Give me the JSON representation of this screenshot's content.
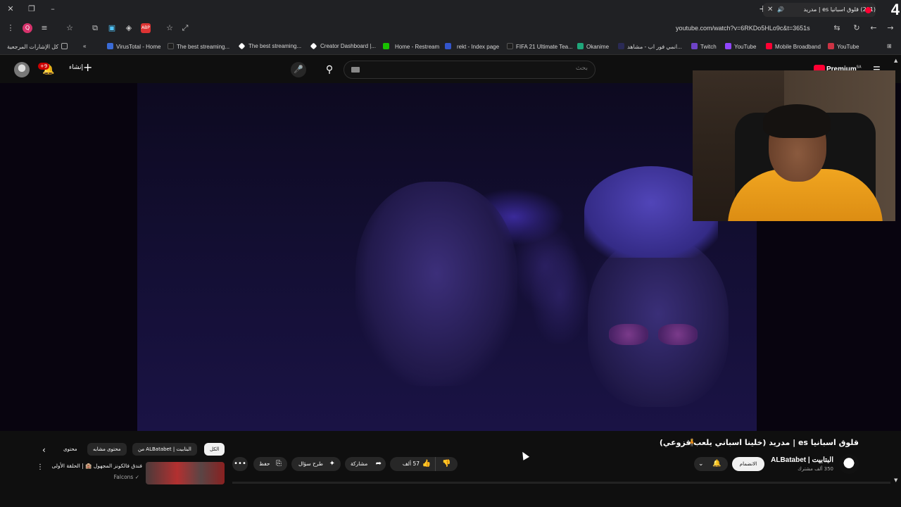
{
  "browser": {
    "tab_title": "(291) قلوق اسبانيا es | مدريد",
    "url": "youtube.com/watch?v=6RKDo5HLo9c&t=3651s",
    "badge_number": "4",
    "bookmarks": [
      {
        "label": "كل الإشارات المرجعية",
        "color": "#8a8a8a"
      },
      {
        "label": "VirusTotal - Home",
        "color": "#3a6bd6"
      },
      {
        "label": "The best streaming...",
        "color": "#1d1d1d"
      },
      {
        "label": "The best streaming...",
        "color": "#ffffff"
      },
      {
        "label": "Creator Dashboard |...",
        "color": "#ffffff"
      },
      {
        "label": "Home - Restream",
        "color": "#18c000"
      },
      {
        "label": "rekt - Index page",
        "color": "#3355cc"
      },
      {
        "label": "FIFA 21 Ultimate Tea...",
        "color": "#1d1d1d"
      },
      {
        "label": "Okanime",
        "color": "#1fa67a"
      },
      {
        "label": "انمي فور اب - مشاهد...",
        "color": "#2a2a55"
      },
      {
        "label": "Twitch",
        "color": "#6e43c6"
      },
      {
        "label": "YouTube",
        "color": "#9146ff"
      },
      {
        "label": "Mobile Broadband",
        "color": "#ff0033"
      },
      {
        "label": "YouTube",
        "color": "#cc3344"
      }
    ]
  },
  "header": {
    "create_label": "إنشاء",
    "notification_count": "+9",
    "search_placeholder": "بحث",
    "premium_label": "Premium",
    "premium_region": "SA"
  },
  "video": {
    "title": "قلوق اسبانيا es | مدريد (خلينا اسباني يلعب قزوعي)",
    "channel_name": "ALBatabet | البتابيت",
    "channel_subs": "350 ألف مشترك",
    "join_label": "الانضمام",
    "likes_label": "57 ألف",
    "share_label": "مشاركة",
    "ask_label": "طرح سؤال",
    "save_label": "حفظ"
  },
  "chips": [
    {
      "label": "الكل",
      "active": true
    },
    {
      "label": "من ALBatabet | البتابيت",
      "active": false
    },
    {
      "label": "محتوى مشابه",
      "active": false
    },
    {
      "label": "محتوى",
      "active": false
    }
  ],
  "recommendation": {
    "title": "فندق فالكونز المجهول 🏨 | الحلقة الأولى",
    "channel": "Falcons"
  }
}
